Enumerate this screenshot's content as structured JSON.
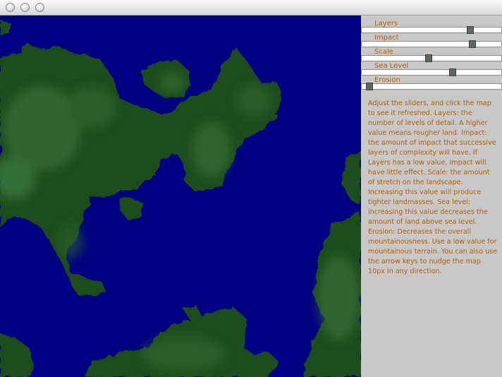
{
  "window": {
    "buttons": [
      "close",
      "minimize",
      "zoom"
    ]
  },
  "map": {
    "sea_color": "#000080",
    "land_color": "#1e4e1e"
  },
  "sliders": [
    {
      "label": "Layers",
      "value": 0.79
    },
    {
      "label": "Impact",
      "value": 0.81
    },
    {
      "label": "Scale",
      "value": 0.48
    },
    {
      "label": "Sea Level",
      "value": 0.66
    },
    {
      "label": "Erosion",
      "value": 0.03
    }
  ],
  "help_text": "Adjust the sliders, and click the map to see it refreshed. Layers: the number of levels of detail. A higher value means rougher land. Impact: the amount of impact that successive layers of complexity will have. If Layers has a low value, Impact will have little effect. Scale: the amount of stretch on the landscape. Increasing this value will produce tighter landmasses. Sea level: increasing this value decreases the amount of land above sea level. Erosion: Decreases the overall mountainousness. Use a low value for mountainous terrain. You can also use the arrow keys to nudge the map 10px in any direction.",
  "colors": {
    "label_text": "#b85c00",
    "panel_bg": "#c8c8c8"
  }
}
